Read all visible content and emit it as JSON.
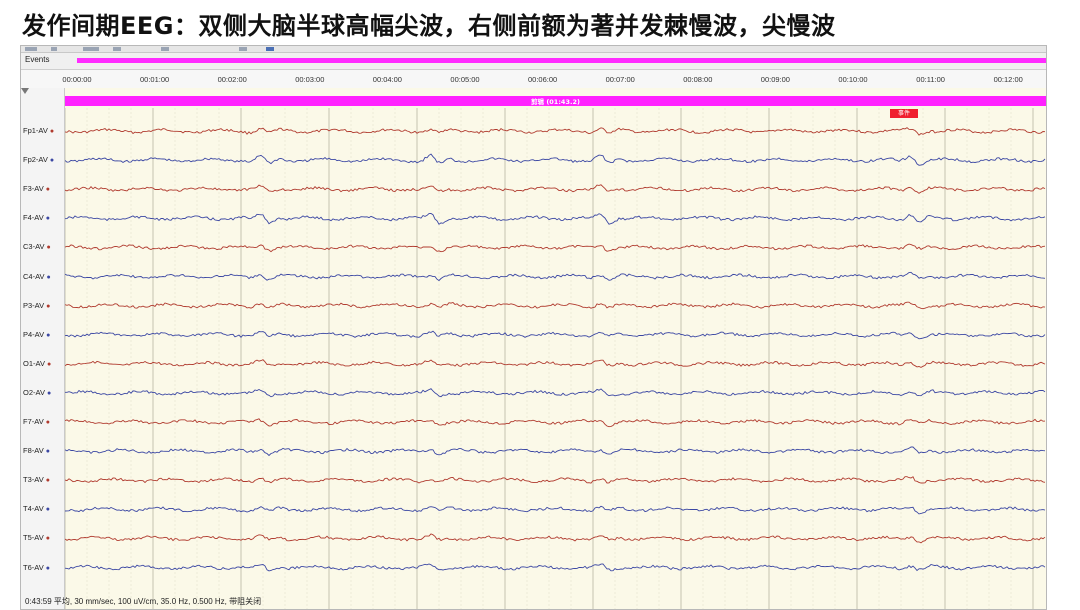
{
  "slide": {
    "title": "发作间期EEG：双侧大脑半球高幅尖波，右侧前额为著并发棘慢波，尖慢波"
  },
  "events_bar": {
    "label": "Events"
  },
  "time_ruler": {
    "ticks": [
      "00:00:00",
      "00:01:00",
      "00:02:00",
      "00:03:00",
      "00:04:00",
      "00:05:00",
      "00:06:00",
      "00:07:00",
      "00:08:00",
      "00:09:00",
      "00:10:00",
      "00:11:00",
      "00:12:00"
    ]
  },
  "event_band": {
    "text": "剪辑 (01:43.2)"
  },
  "event_marker": {
    "text": "事件"
  },
  "channels": [
    {
      "label": "Fp1-AV",
      "color": "#b03a2e"
    },
    {
      "label": "Fp2-AV",
      "color": "#3b47a3"
    },
    {
      "label": "F3-AV",
      "color": "#b03a2e"
    },
    {
      "label": "F4-AV",
      "color": "#3b47a3"
    },
    {
      "label": "C3-AV",
      "color": "#b03a2e"
    },
    {
      "label": "C4-AV",
      "color": "#3b47a3"
    },
    {
      "label": "P3-AV",
      "color": "#b03a2e"
    },
    {
      "label": "P4-AV",
      "color": "#3b47a3"
    },
    {
      "label": "O1-AV",
      "color": "#b03a2e"
    },
    {
      "label": "O2-AV",
      "color": "#3b47a3"
    },
    {
      "label": "F7-AV",
      "color": "#b03a2e"
    },
    {
      "label": "F8-AV",
      "color": "#3b47a3"
    },
    {
      "label": "T3-AV",
      "color": "#b03a2e"
    },
    {
      "label": "T4-AV",
      "color": "#3b47a3"
    },
    {
      "label": "T5-AV",
      "color": "#b03a2e"
    },
    {
      "label": "T6-AV",
      "color": "#3b47a3"
    }
  ],
  "status": {
    "text": "0:43:59 平均, 30 mm/sec, 100 uV/cm, 35.0 Hz, 0.500 Hz, 带阻关闭"
  },
  "icons": {
    "pointer": "pointer-triangle-icon",
    "channel_dot": "dot-icon"
  }
}
